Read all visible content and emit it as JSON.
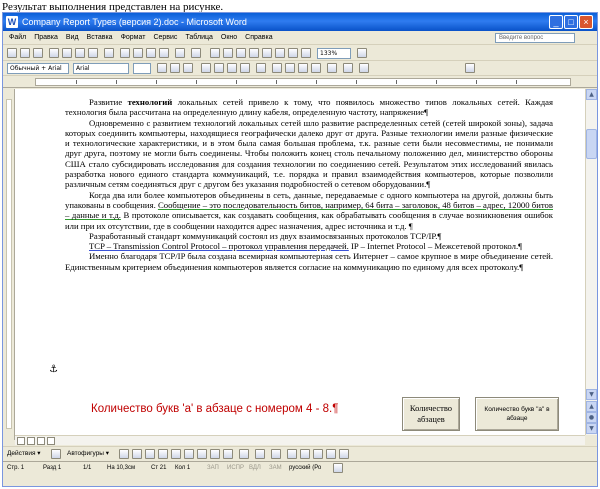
{
  "caption": "Результат выполнения представлен на рисунке.",
  "window": {
    "title": "Company Report Types (версия 2).doc - Microsoft Word",
    "minimize": "_",
    "maximize": "□",
    "close": "×"
  },
  "menu": {
    "items": [
      "Файл",
      "Правка",
      "Вид",
      "Вставка",
      "Формат",
      "Сервис",
      "Таблица",
      "Окно",
      "Справка"
    ],
    "help_placeholder": "Введите вопрос"
  },
  "toolbar": {
    "zoom": "133%",
    "style": "Обычный + Arial",
    "font": "Arial"
  },
  "document": {
    "paragraphs": [
      {
        "lead": "Развитие ",
        "bold": "технологий",
        "rest": " локальных сетей привело к тому, что появилось множество типов локальных сетей. Каждая технология была рассчитана на определенную длину кабеля, определенную частоту, напряжение¶"
      },
      {
        "text": "Одновременно с развитием технологий локальных сетей шло развитие распределенных сетей (сетей широкой зоны), задача которых соединить компьютеры, находящиеся географически далеко друг от друга. Разные технологии имели разные физические и технологические характеристики, и в этом была самая большая проблема, т.к. разные сети были несовместимы, не понимали друг друга, поэтому не могли быть соединены. Чтобы положить конец столь печальному положению дел, министерство обороны США стало субсидировать исследования для создания технологии по соединению сетей. Результатом этих исследований явилась разработка нового единого стандарта коммуникаций, т.е. порядка и правил взаимодействия компьютеров, которые позволили различным сетям соединяться друг с другом без указания подробностей о сетевом оборудовании.¶"
      },
      {
        "lead": "Когда два или более компьютеров объединены в сеть, данные, передаваемые с одного компьютера на другой, должны быть упакованы в сообщения. ",
        "underlined": "Сообщение – это последовательность битов, например, 64 бита – заголовок, 48 битов – адрес, 12000 битов – данные и т.д.",
        "rest": " В протоколе описывается, как создавать сообщения, как обрабатывать сообщения в случае возникновения ошибок или при их отсутствии, где в сообщении находится адрес назначения, адрес источника и т.д. ¶"
      },
      {
        "text": "Разработанный стандарт коммуникаций состоял из двух взаимосвязанных протоколов TCP/IP.¶"
      },
      {
        "underlined": "TCP – Transmission Control Protocol – протокол управления передачей.",
        "rest": " IP – Internet Protocol – Межсетевой протокол.¶"
      },
      {
        "text": "Именно благодаря TCP/IP была создана всемирная компьютерная сеть Интернет – самое крупное в мире объединение сетей. Единственным критерием объединения компьютеров является согласие на коммуникацию по единому для всех протоколу.¶"
      }
    ],
    "result": "Количество букв 'а' в абзаце с номером 4 - 8.¶",
    "anchor": "⚓"
  },
  "buttons": {
    "count_paragraphs": "Количество абзацев",
    "count_letters": "Количество букв \"а\" в абзаце"
  },
  "drawbar": {
    "actions": "Действия ▾",
    "autoshapes": "Автофигуры ▾"
  },
  "status": {
    "page": "Стр. 1",
    "section": "Разд 1",
    "pages": "1/1",
    "position": "На 10,3см",
    "line": "Ст 21",
    "column": "Кол 1",
    "rec": "ЗАП",
    "trk": "ИСПР",
    "ext": "ВДЛ",
    "ovr": "ЗАМ",
    "lang": "русский (Ро"
  }
}
